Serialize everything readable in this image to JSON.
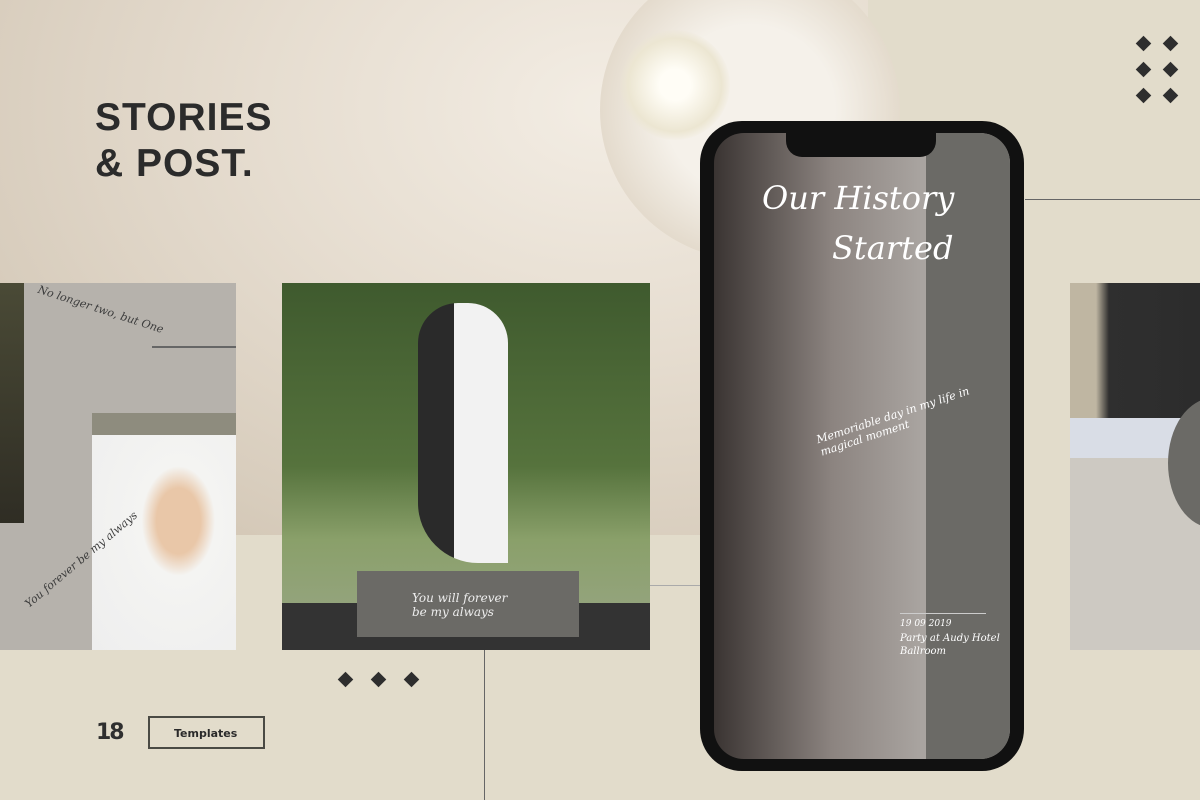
{
  "title": {
    "line1": "STORIES",
    "line2": "& POST."
  },
  "card1": {
    "text1": "No longer two, but One",
    "text2": "You forever be my always"
  },
  "card2": {
    "caption_line1": "You will forever",
    "caption_line2": "be my always"
  },
  "story": {
    "heading_line1": "Our History",
    "heading_line2": "Started",
    "arc_text": "Memoriable day in my life in magical moment",
    "date": "19 09 2019",
    "event_line1": "Party at Audy Hotel",
    "event_line2": "Ballroom"
  },
  "footer": {
    "logo": "18",
    "button": "Templates"
  },
  "colors": {
    "background": "#e2dccb",
    "dark": "#2e2e2e",
    "panel": "#6b6a66"
  }
}
